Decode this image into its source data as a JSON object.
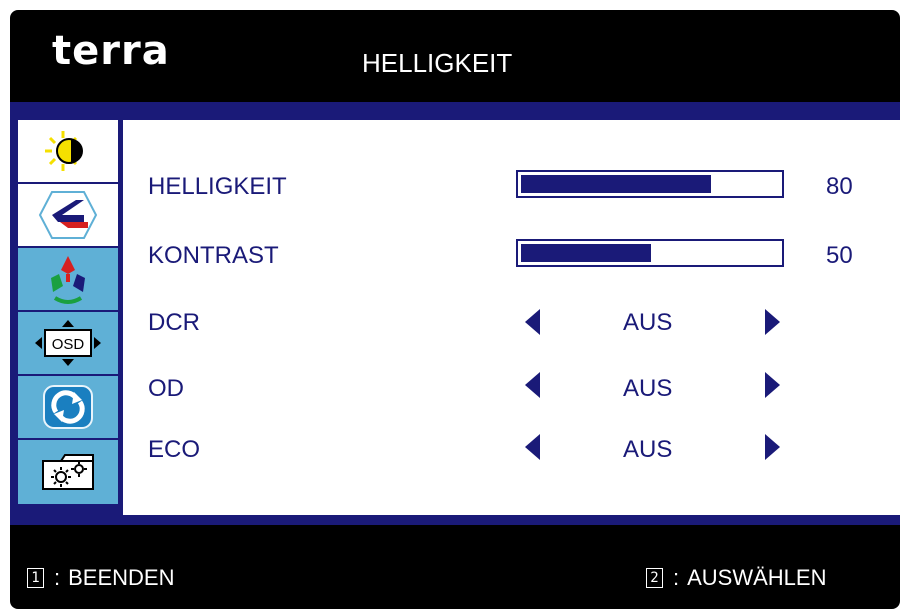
{
  "header": {
    "brand": "terra",
    "title": "HELLIGKEIT"
  },
  "sidebar": {
    "items": [
      {
        "icon": "brightness-icon",
        "active": true
      },
      {
        "icon": "image-icon",
        "active": true
      },
      {
        "icon": "color-icon",
        "active": false
      },
      {
        "icon": "osd-icon",
        "active": false
      },
      {
        "icon": "reset-icon",
        "active": false
      },
      {
        "icon": "setup-icon",
        "active": false
      }
    ]
  },
  "menu": {
    "items": [
      {
        "label": "HELLIGKEIT",
        "type": "slider",
        "value": "80"
      },
      {
        "label": "KONTRAST",
        "type": "slider",
        "value": "50"
      },
      {
        "label": "DCR",
        "type": "option",
        "value": "AUS"
      },
      {
        "label": "OD",
        "type": "option",
        "value": "AUS"
      },
      {
        "label": "ECO",
        "type": "option",
        "value": "AUS"
      }
    ]
  },
  "footer": {
    "exit_key": "1",
    "exit_sep": ":",
    "exit_label": "BEENDEN",
    "select_key": "2",
    "select_sep": ":",
    "select_label": "AUSWÄHLEN"
  },
  "colors": {
    "navy": "#1a1a78",
    "sidebar_blue": "#5fb0d6",
    "background": "#000000"
  }
}
